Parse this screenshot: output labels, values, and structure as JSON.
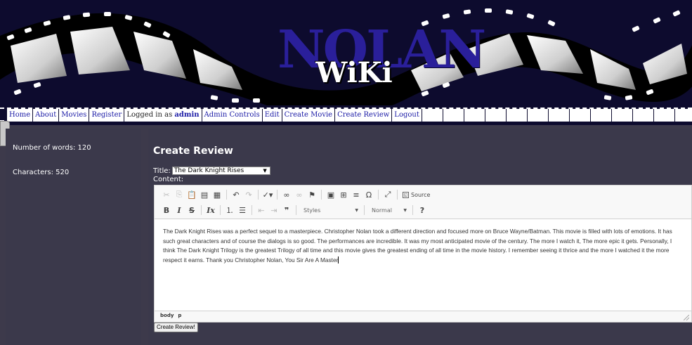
{
  "brand": {
    "logo_main": "NOLAN",
    "logo_sub": "WiKi"
  },
  "nav": {
    "home": "Home",
    "about": "About",
    "movies": "Movies",
    "register": "Register",
    "logged_in_prefix": "Logged in as",
    "username": "admin",
    "admin_controls": "Admin Controls",
    "edit": "Edit",
    "create_movie": "Create Movie",
    "create_review": "Create Review",
    "logout": "Logout"
  },
  "sidebar": {
    "words": "Number of words: 120",
    "characters": "Characters: 520"
  },
  "form": {
    "page_title": "Create Review",
    "title_label": "Title:",
    "title_value": "The Dark Knight Rises",
    "content_label": "Content:",
    "submit_label": "Create Review!"
  },
  "editor": {
    "toolbar_row1_icons": [
      "cut-icon",
      "copy-icon",
      "paste-icon",
      "paste-text-icon",
      "paste-word-icon",
      "undo-icon",
      "redo-icon",
      "spellcheck-icon",
      "link-icon",
      "unlink-icon",
      "anchor-icon",
      "image-icon",
      "table-icon",
      "horizontal-rule-icon",
      "special-char-icon",
      "maximize-icon",
      "source-icon"
    ],
    "source_label": "Source",
    "styles_label": "Styles",
    "format_label": "Normal",
    "help_label": "?",
    "body_text": "The Dark Knight Rises was a perfect sequel to a masterpiece. Christopher Nolan took a different direction and focused more on Bruce Wayne/Batman. This movie is filled with lots of emotions. It has such great characters and of course the dialogs is so good. The performances are incredible. It was my most anticipated movie of the century. The more I watch it, The more epic it gets. Personally, I think The Dark Knight Trilogy is the greatest Trilogy of all time and this movie gives the greatest ending of all time in the movie history. I remember seeing it thrice and the more I watched it the more respect it earns. Thank you Christopher Nolan, You Sir Are A Master",
    "path": [
      "body",
      "p"
    ]
  },
  "colors": {
    "banner_bg": "#0d0b2e",
    "panel_bg": "#3b394b",
    "nav_link": "#1a1aa6",
    "logo_blue": "#2a1f9a"
  }
}
